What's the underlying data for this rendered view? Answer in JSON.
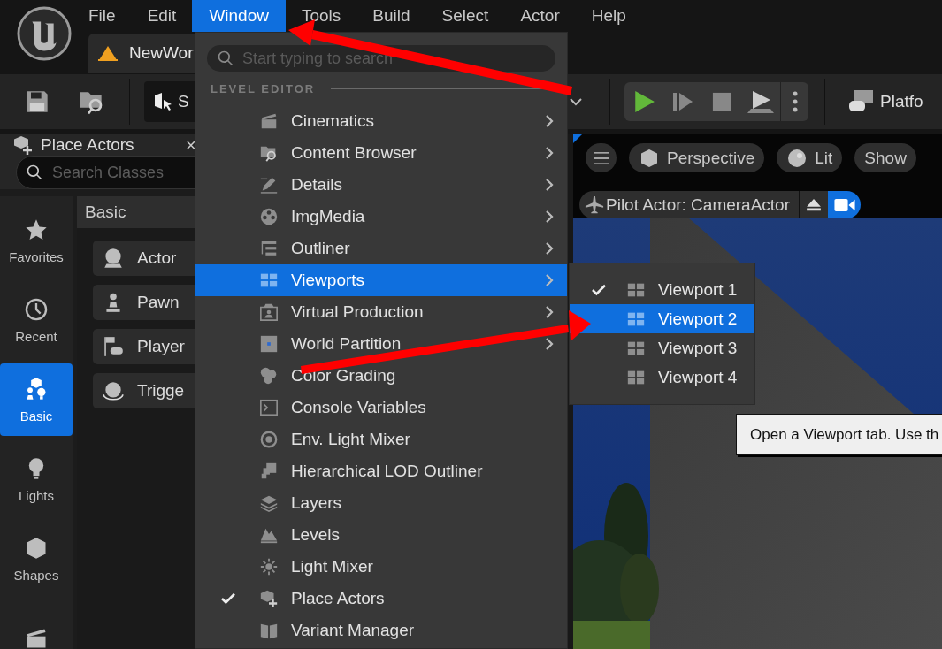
{
  "menu_bar": {
    "items": [
      {
        "label": "File",
        "selected": false
      },
      {
        "label": "Edit",
        "selected": false
      },
      {
        "label": "Window",
        "selected": true
      },
      {
        "label": "Tools",
        "selected": false
      },
      {
        "label": "Build",
        "selected": false
      },
      {
        "label": "Select",
        "selected": false
      },
      {
        "label": "Actor",
        "selected": false
      },
      {
        "label": "Help",
        "selected": false
      }
    ]
  },
  "document_tab": {
    "label": "NewWor"
  },
  "toolbar": {
    "mode_label": "S",
    "platforms_label": "Platfo"
  },
  "place_actors": {
    "title": "Place Actors",
    "close": "×",
    "search": {
      "placeholder": "Search Classes"
    },
    "categories": [
      {
        "label": "Favorites",
        "selected": false
      },
      {
        "label": "Recent",
        "selected": false
      },
      {
        "label": "Basic",
        "selected": true
      },
      {
        "label": "Lights",
        "selected": false
      },
      {
        "label": "Shapes",
        "selected": false
      },
      {
        "selected": false
      }
    ],
    "section": "Basic",
    "items": [
      {
        "label": "Actor"
      },
      {
        "label": "Pawn"
      },
      {
        "label": "Player"
      },
      {
        "label": "Trigge"
      }
    ]
  },
  "viewport": {
    "view_buttons": [
      "Perspective",
      "Lit",
      "Show"
    ],
    "pilot": "Pilot Actor: CameraActor",
    "scene": {
      "kind": "picture"
    }
  },
  "window_menu": {
    "search": {
      "placeholder": "Start typing to search"
    },
    "section": "LEVEL EDITOR",
    "items": [
      {
        "label": "Cinematics",
        "submenu": true,
        "checked": false,
        "selected": false
      },
      {
        "label": "Content Browser",
        "submenu": true,
        "checked": false,
        "selected": false
      },
      {
        "label": "Details",
        "submenu": true,
        "checked": false,
        "selected": false
      },
      {
        "label": "ImgMedia",
        "submenu": true,
        "checked": false,
        "selected": false
      },
      {
        "label": "Outliner",
        "submenu": true,
        "checked": false,
        "selected": false
      },
      {
        "label": "Viewports",
        "submenu": true,
        "checked": false,
        "selected": true
      },
      {
        "label": "Virtual Production",
        "submenu": true,
        "checked": false,
        "selected": false
      },
      {
        "label": "World Partition",
        "submenu": true,
        "checked": false,
        "selected": false
      },
      {
        "label": "Color Grading",
        "submenu": false,
        "checked": false,
        "selected": false
      },
      {
        "label": "Console Variables",
        "submenu": false,
        "checked": false,
        "selected": false
      },
      {
        "label": "Env. Light Mixer",
        "submenu": false,
        "checked": false,
        "selected": false
      },
      {
        "label": "Hierarchical LOD Outliner",
        "submenu": false,
        "checked": false,
        "selected": false
      },
      {
        "label": "Layers",
        "submenu": false,
        "checked": false,
        "selected": false
      },
      {
        "label": "Levels",
        "submenu": false,
        "checked": false,
        "selected": false
      },
      {
        "label": "Light Mixer",
        "submenu": false,
        "checked": false,
        "selected": false
      },
      {
        "label": "Place Actors",
        "submenu": false,
        "checked": true,
        "selected": false
      },
      {
        "label": "Variant Manager",
        "submenu": false,
        "checked": false,
        "selected": false
      }
    ]
  },
  "viewports_submenu": {
    "items": [
      {
        "label": "Viewport 1",
        "checked": true,
        "selected": false
      },
      {
        "label": "Viewport 2",
        "checked": false,
        "selected": true
      },
      {
        "label": "Viewport 3",
        "checked": false,
        "selected": false
      },
      {
        "label": "Viewport 4",
        "checked": false,
        "selected": false
      }
    ]
  },
  "tooltip": {
    "text": "Open a Viewport tab. Use th"
  }
}
